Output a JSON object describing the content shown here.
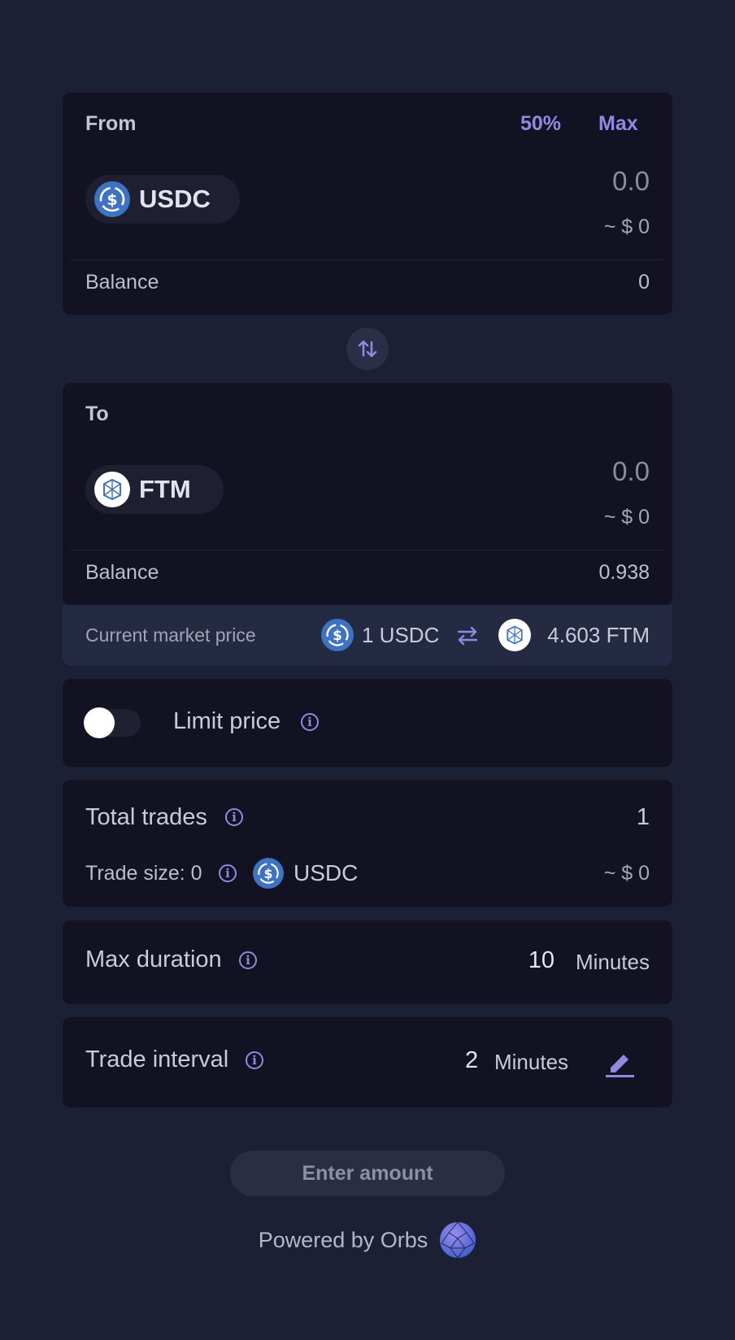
{
  "from": {
    "label": "From",
    "pct_50": "50%",
    "max": "Max",
    "token": "USDC",
    "amount": "0.0",
    "usd_value": "~ $ 0",
    "balance_label": "Balance",
    "balance_value": "0"
  },
  "to": {
    "label": "To",
    "token": "FTM",
    "amount": "0.0",
    "usd_value": "~ $ 0",
    "balance_label": "Balance",
    "balance_value": "0.938"
  },
  "market": {
    "label": "Current market price",
    "left": "1 USDC",
    "right": "4.603 FTM"
  },
  "limit": {
    "label": "Limit price",
    "enabled": false
  },
  "trades": {
    "total_label": "Total trades",
    "total_value": "1",
    "size_label": "Trade size: 0",
    "size_token": "USDC",
    "size_usd": "~ $ 0"
  },
  "duration": {
    "label": "Max duration",
    "value": "10",
    "unit": "Minutes"
  },
  "interval": {
    "label": "Trade interval",
    "value": "2",
    "unit": "Minutes"
  },
  "submit_label": "Enter amount",
  "footer": "Powered by Orbs",
  "colors": {
    "background": "#1b2034",
    "card": "#121223",
    "accent": "#8e8ae0",
    "usdc": "#3e73c4"
  }
}
